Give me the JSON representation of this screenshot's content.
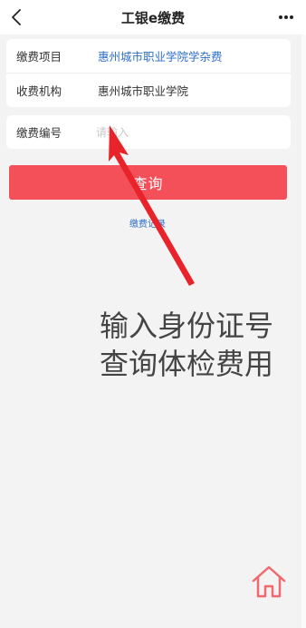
{
  "header": {
    "title": "工银e缴费",
    "back_icon": "chevron-left-icon",
    "more_icon": "more-dots-icon"
  },
  "info_card": {
    "item_label": "缴费项目",
    "item_value": "惠州城市职业学院学杂费",
    "org_label": "收费机构",
    "org_value": "惠州城市职业学院"
  },
  "payment_number": {
    "label": "缴费编号",
    "value": "",
    "placeholder": "请输入"
  },
  "query_button": {
    "label": "查询"
  },
  "records_link": {
    "label": "缴费记录"
  },
  "annotation": {
    "line1": "输入身份证号",
    "line2": "查询体检费用",
    "arrow_color": "#e8232a"
  },
  "home_button": {
    "icon": "home-icon",
    "color": "#f06a6f"
  },
  "colors": {
    "primary": "#f4505a",
    "link": "#2e6ec8",
    "background": "#f3f3f3"
  }
}
